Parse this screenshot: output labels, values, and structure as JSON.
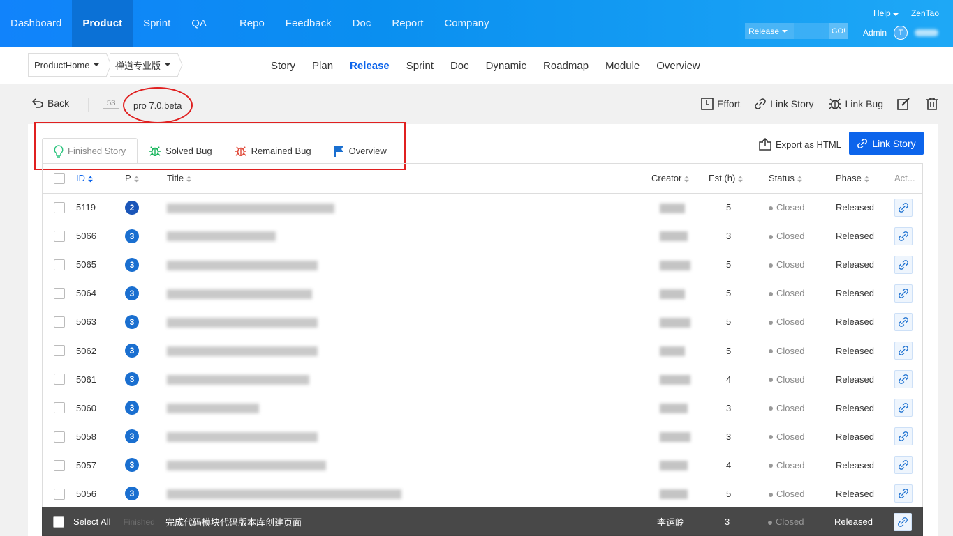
{
  "topnav": {
    "items": [
      "Dashboard",
      "Product",
      "Sprint",
      "QA",
      "Repo",
      "Feedback",
      "Doc",
      "Report",
      "Company"
    ],
    "active_index": 1,
    "help": "Help",
    "brand": "ZenTao",
    "search_type": "Release",
    "go_label": "GO!",
    "user_label": "Admin",
    "avatar_letter": "T"
  },
  "subnav": {
    "product_home": "ProductHome",
    "product_name": "禅道专业版",
    "items": [
      "Story",
      "Plan",
      "Release",
      "Sprint",
      "Doc",
      "Dynamic",
      "Roadmap",
      "Module",
      "Overview"
    ],
    "active_index": 2
  },
  "actionbar": {
    "back": "Back",
    "release_id": "53",
    "release_name": "pro 7.0.beta",
    "effort": "Effort",
    "link_story": "Link Story",
    "link_bug": "Link Bug"
  },
  "tabs": [
    "Finished Story",
    "Solved Bug",
    "Remained Bug",
    "Overview"
  ],
  "export_html": "Export as HTML",
  "link_story_button": "Link Story",
  "table": {
    "headers": {
      "id": "ID",
      "p": "P",
      "title": "Title",
      "creator": "Creator",
      "est": "Est.(h)",
      "status": "Status",
      "phase": "Phase",
      "act": "Act..."
    },
    "rows": [
      {
        "id": "5119",
        "p": "2",
        "est": "5",
        "status": "Closed",
        "phase": "Released"
      },
      {
        "id": "5066",
        "p": "3",
        "est": "3",
        "status": "Closed",
        "phase": "Released"
      },
      {
        "id": "5065",
        "p": "3",
        "est": "5",
        "status": "Closed",
        "phase": "Released"
      },
      {
        "id": "5064",
        "p": "3",
        "est": "5",
        "status": "Closed",
        "phase": "Released"
      },
      {
        "id": "5063",
        "p": "3",
        "est": "5",
        "status": "Closed",
        "phase": "Released"
      },
      {
        "id": "5062",
        "p": "3",
        "est": "5",
        "status": "Closed",
        "phase": "Released"
      },
      {
        "id": "5061",
        "p": "3",
        "est": "4",
        "status": "Closed",
        "phase": "Released"
      },
      {
        "id": "5060",
        "p": "3",
        "est": "3",
        "status": "Closed",
        "phase": "Released"
      },
      {
        "id": "5058",
        "p": "3",
        "est": "3",
        "status": "Closed",
        "phase": "Released"
      },
      {
        "id": "5057",
        "p": "3",
        "est": "4",
        "status": "Closed",
        "phase": "Released"
      },
      {
        "id": "5056",
        "p": "3",
        "est": "5",
        "status": "Closed",
        "phase": "Released"
      }
    ],
    "last_row": {
      "title": "完成代码模块代码版本库创建页面",
      "creator": "李运岭",
      "est": "3",
      "status": "Closed",
      "phase": "Released"
    }
  },
  "footer": {
    "select_all": "Select All",
    "partial": "Finished"
  }
}
